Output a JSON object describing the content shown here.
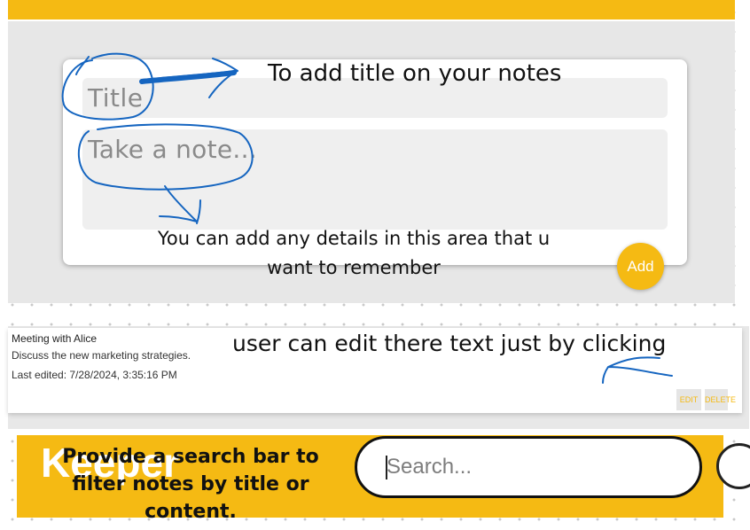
{
  "create_note": {
    "title_placeholder": "Title",
    "content_placeholder": "Take a note...",
    "add_label": "Add"
  },
  "annotations": {
    "title_hint": "To add title on your notes",
    "content_hint": "You can add any details in this area that u want to remember",
    "edit_hint": "user can edit there text just by clicking",
    "search_hint": "Provide a search bar to filter notes by title or content."
  },
  "note": {
    "title": "Meeting with Alice",
    "content": "Discuss the new marketing strategies.",
    "last_edited": "Last edited: 7/28/2024, 3:35:16 PM",
    "edit_label": "EDIT",
    "delete_label": "DELETE"
  },
  "header": {
    "logo": "Keeper",
    "search_placeholder": "Search..."
  },
  "colors": {
    "accent": "#f5ba13",
    "annotation_ink": "#1565c0"
  }
}
